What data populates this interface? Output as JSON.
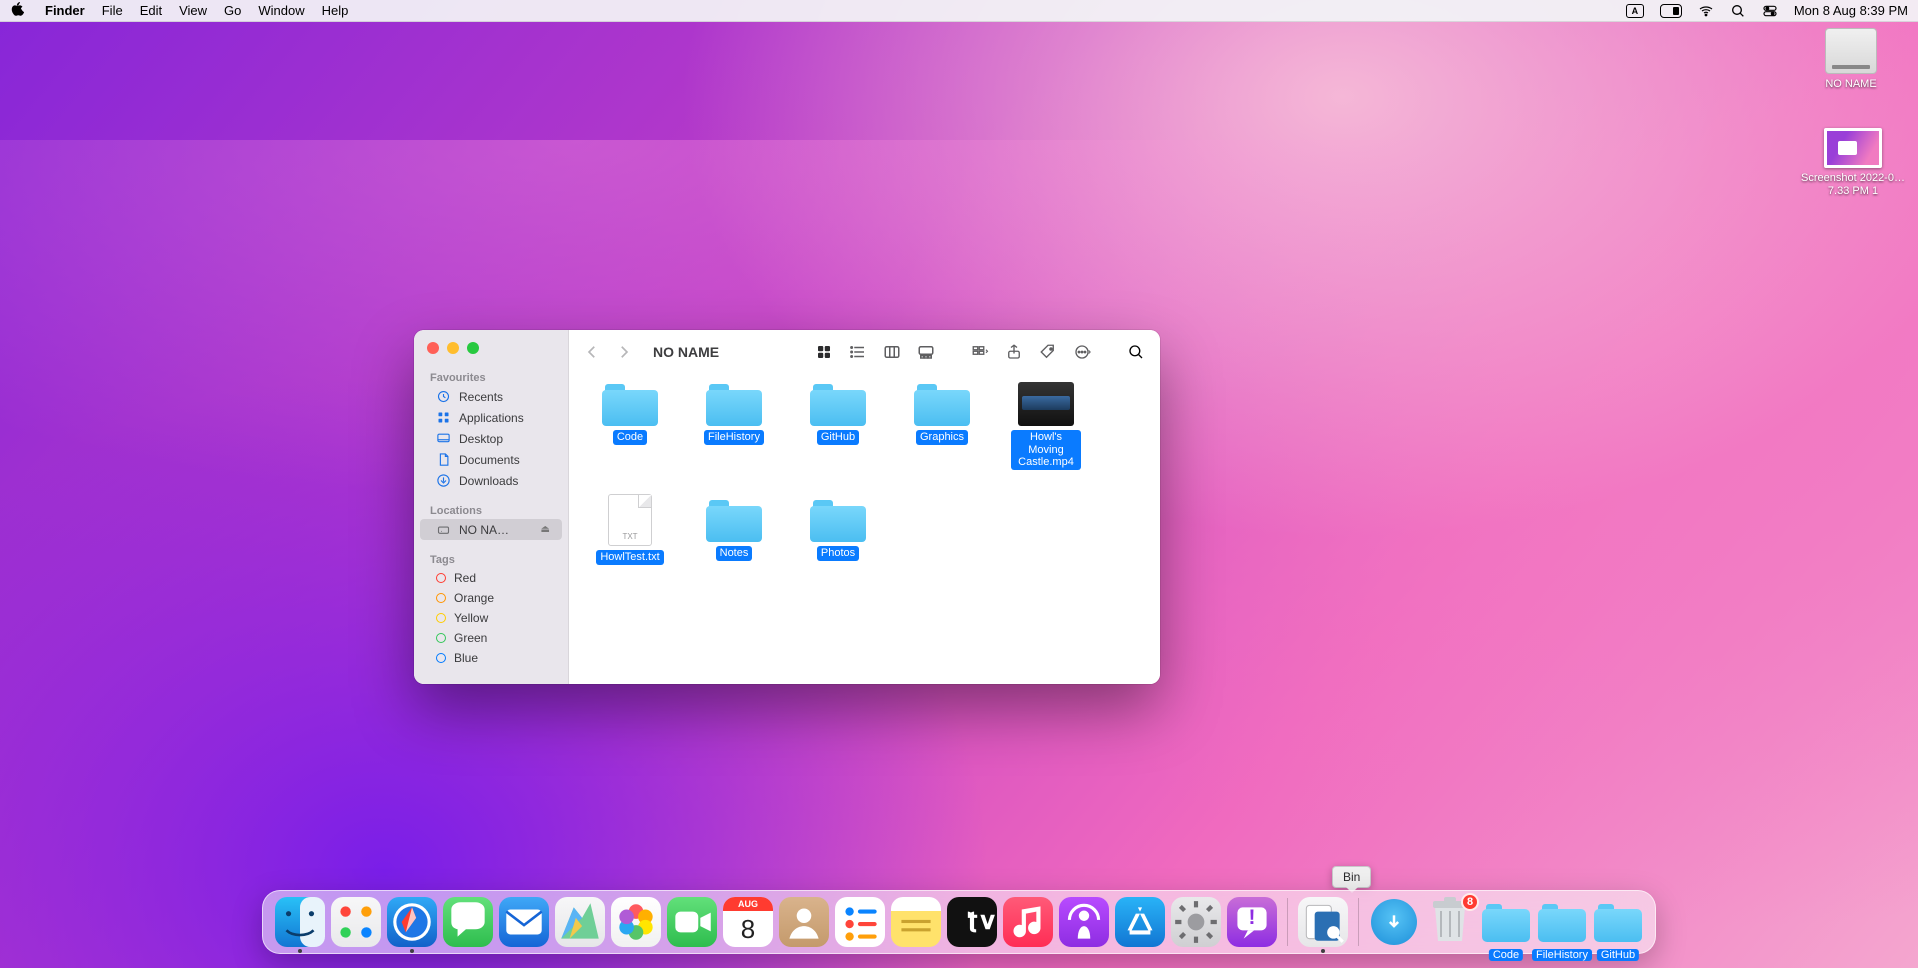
{
  "menubar": {
    "app": "Finder",
    "items": [
      "File",
      "Edit",
      "View",
      "Go",
      "Window",
      "Help"
    ],
    "keyboard_indicator": "A",
    "datetime": "Mon 8 Aug  8:39 PM"
  },
  "desktop": {
    "drive_label": "NO NAME",
    "screenshot_label": "Screenshot 2022-0…7.33 PM 1"
  },
  "finder": {
    "title": "NO NAME",
    "sidebar": {
      "favourites_header": "Favourites",
      "locations_header": "Locations",
      "tags_header": "Tags",
      "favourites": [
        {
          "icon": "clock",
          "label": "Recents"
        },
        {
          "icon": "apps",
          "label": "Applications"
        },
        {
          "icon": "desktop",
          "label": "Desktop"
        },
        {
          "icon": "doc",
          "label": "Documents"
        },
        {
          "icon": "download",
          "label": "Downloads"
        }
      ],
      "locations": [
        {
          "icon": "drive",
          "label": "NO NA…",
          "eject": true,
          "selected": true
        }
      ],
      "tags": [
        {
          "color": "#ff3b30",
          "label": "Red"
        },
        {
          "color": "#ff9500",
          "label": "Orange"
        },
        {
          "color": "#ffcc00",
          "label": "Yellow"
        },
        {
          "color": "#34c759",
          "label": "Green"
        },
        {
          "color": "#007aff",
          "label": "Blue"
        }
      ]
    },
    "items": [
      {
        "type": "folder",
        "name": "Code"
      },
      {
        "type": "folder",
        "name": "FileHistory"
      },
      {
        "type": "folder",
        "name": "GitHub"
      },
      {
        "type": "folder",
        "name": "Graphics"
      },
      {
        "type": "video",
        "name": "Howl's Moving Castle.mp4"
      },
      {
        "type": "txt",
        "name": "HowlTest.txt"
      },
      {
        "type": "folder",
        "name": "Notes"
      },
      {
        "type": "folder",
        "name": "Photos"
      }
    ],
    "txt_badge": "TXT"
  },
  "dock": {
    "tooltip": "Bin",
    "trash_badge": "8",
    "apps": [
      {
        "name": "finder",
        "bg": "linear-gradient(#29c1f7,#1276d3)",
        "running": true
      },
      {
        "name": "launchpad",
        "bg": "linear-gradient(#f7f7f8,#e9e9eb)"
      },
      {
        "name": "safari",
        "bg": "linear-gradient(#2fa9f6,#1261c9)",
        "running": true
      },
      {
        "name": "messages",
        "bg": "linear-gradient(#62e07a,#2ebd4e)"
      },
      {
        "name": "mail",
        "bg": "linear-gradient(#3fa8f7,#1565d6)"
      },
      {
        "name": "maps",
        "bg": "linear-gradient(#f7f7f8,#e6e6e8)"
      },
      {
        "name": "photos",
        "bg": "linear-gradient(#ffffff,#f1f1f1)"
      },
      {
        "name": "facetime",
        "bg": "linear-gradient(#62e07a,#2ebd4e)"
      },
      {
        "name": "calendar",
        "bg": "#ffffff",
        "cal_top": "AUG",
        "cal_day": "8"
      },
      {
        "name": "contacts",
        "bg": "linear-gradient(#d9b38c,#c49a6c)"
      },
      {
        "name": "reminders",
        "bg": "#ffffff"
      },
      {
        "name": "notes",
        "bg": "linear-gradient(#fff 0 28%,#ffe26b 28% 100%)"
      },
      {
        "name": "tv",
        "bg": "#111"
      },
      {
        "name": "music",
        "bg": "linear-gradient(#ff5a78,#ff2d55)"
      },
      {
        "name": "podcasts",
        "bg": "linear-gradient(#b84bff,#8e2de2)"
      },
      {
        "name": "appstore",
        "bg": "linear-gradient(#29b3f7,#1276d3)"
      },
      {
        "name": "settings",
        "bg": "linear-gradient(#e9e9eb,#cfcfd2)"
      },
      {
        "name": "feedback",
        "bg": "linear-gradient(#c86dd7,#8e2de2)"
      }
    ],
    "recent": [
      {
        "name": "preview",
        "bg": "linear-gradient(#f7f7f8,#e6e6e8)",
        "running": true
      }
    ],
    "right": [
      {
        "name": "downloads",
        "type": "downloads"
      },
      {
        "name": "trash",
        "type": "trash"
      }
    ],
    "minimized": [
      {
        "name": "Code"
      },
      {
        "name": "FileHistory"
      },
      {
        "name": "GitHub"
      }
    ]
  }
}
